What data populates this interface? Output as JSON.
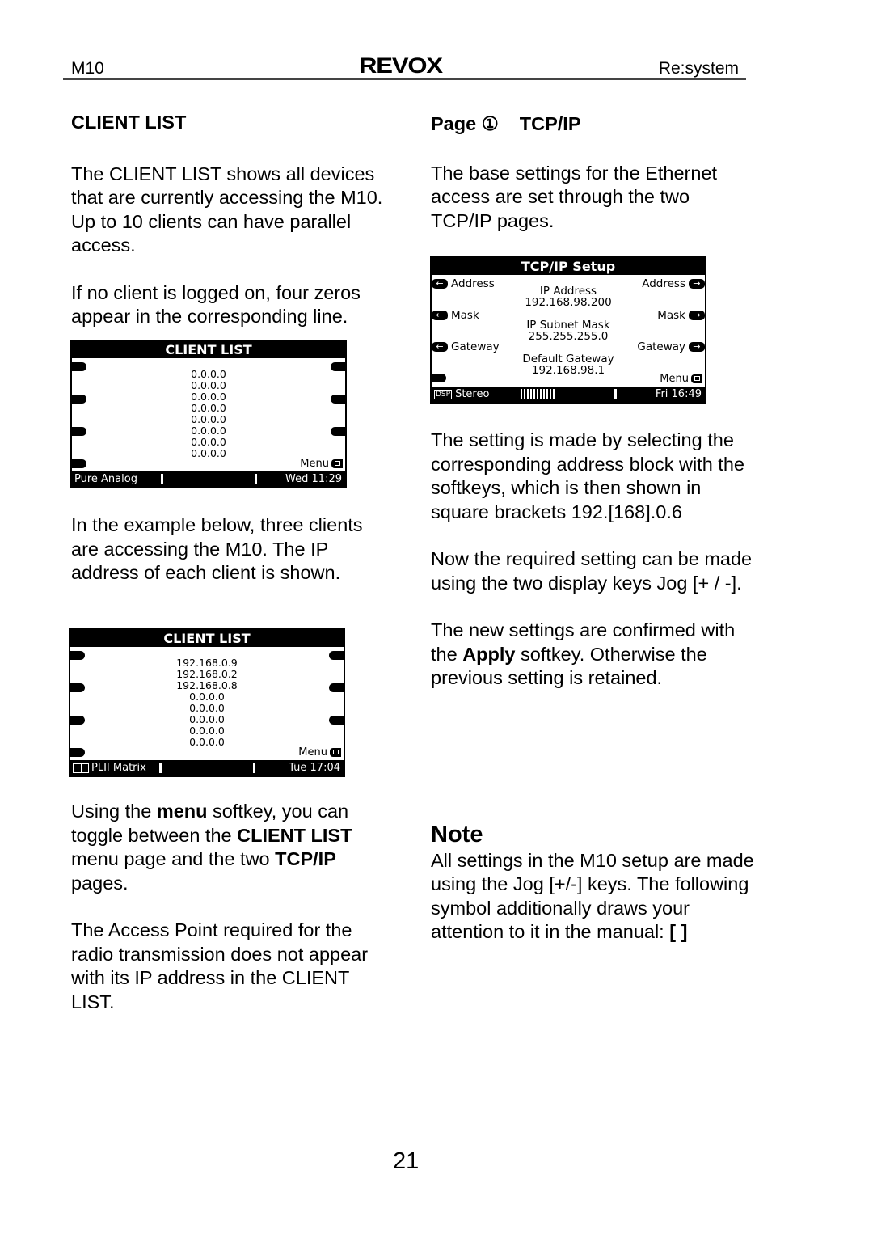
{
  "header": {
    "left": "M10",
    "logo": "REVOX",
    "right": "Re:system"
  },
  "left_column": {
    "heading": "CLIENT LIST",
    "para1": "The CLIENT LIST shows all devices that are currently accessing the M10. Up to 10 clients can have parallel access.",
    "para2": "If no client is logged on, four zeros appear in the corresponding line.",
    "screen1": {
      "title": "CLIENT LIST",
      "clients": [
        "0.0.0.0",
        "0.0.0.0",
        "0.0.0.0",
        "0.0.0.0",
        "0.0.0.0",
        "0.0.0.0",
        "0.0.0.0",
        "0.0.0.0"
      ],
      "menu_label": "Menu",
      "footer_left": "Pure Analog",
      "footer_right": "Wed 11:29"
    },
    "para3": "In the example below, three clients are accessing the M10. The IP address of each client is shown.",
    "screen2": {
      "title": "CLIENT LIST",
      "clients": [
        "192.168.0.9",
        "192.168.0.2",
        "192.168.0.8",
        "0.0.0.0",
        "0.0.0.0",
        "0.0.0.0",
        "0.0.0.0",
        "0.0.0.0"
      ],
      "menu_label": "Menu",
      "footer_left": "PLII Matrix",
      "footer_right": "Tue 17:04"
    },
    "para4": {
      "t1": "Using the ",
      "b1": "menu",
      "t2": " softkey, you can toggle between the ",
      "b2": "CLIENT LIST",
      "t3": " menu page and the two ",
      "b3": "TCP/IP",
      "t4": " pages."
    },
    "para5": "The Access Point required for the radio transmission does not appear with its IP address in the CLIENT LIST."
  },
  "right_column": {
    "heading_page": "Page ①",
    "heading_title": "TCP/IP",
    "para1": "The base settings for the Ethernet access are set through the two TCP/IP pages.",
    "screen": {
      "title": "TCP/IP Setup",
      "left_keys": [
        "Address",
        "Mask",
        "Gateway"
      ],
      "right_keys": [
        "Address",
        "Mask",
        "Gateway"
      ],
      "ip_label": "IP Address",
      "ip_value": "192.168.98.200",
      "mask_label": "IP Subnet Mask",
      "mask_value": "255.255.255.0",
      "gw_label": "Default Gateway",
      "gw_value": "192.168.98.1",
      "menu_label": "Menu",
      "footer_badge": "DSP",
      "footer_left": "Stereo",
      "footer_right": "Fri 16:49"
    },
    "para2": "The setting is made by selecting the corresponding address block with the softkeys, which is then shown in square brackets 192.[168].0.6",
    "para3": "Now the required setting can be made using the two display keys Jog [+ / -].",
    "para4": {
      "t1": "The new settings are confirmed with the ",
      "b1": "Apply",
      "t2": " softkey. Otherwise the previous setting is retained."
    },
    "note_title": "Note",
    "note_text": "All settings in the M10 setup are made using the Jog [+/-] keys. The following symbol additionally draws your attention to it in the manual: ",
    "note_symbol": "[ ]"
  },
  "page_number": "21"
}
